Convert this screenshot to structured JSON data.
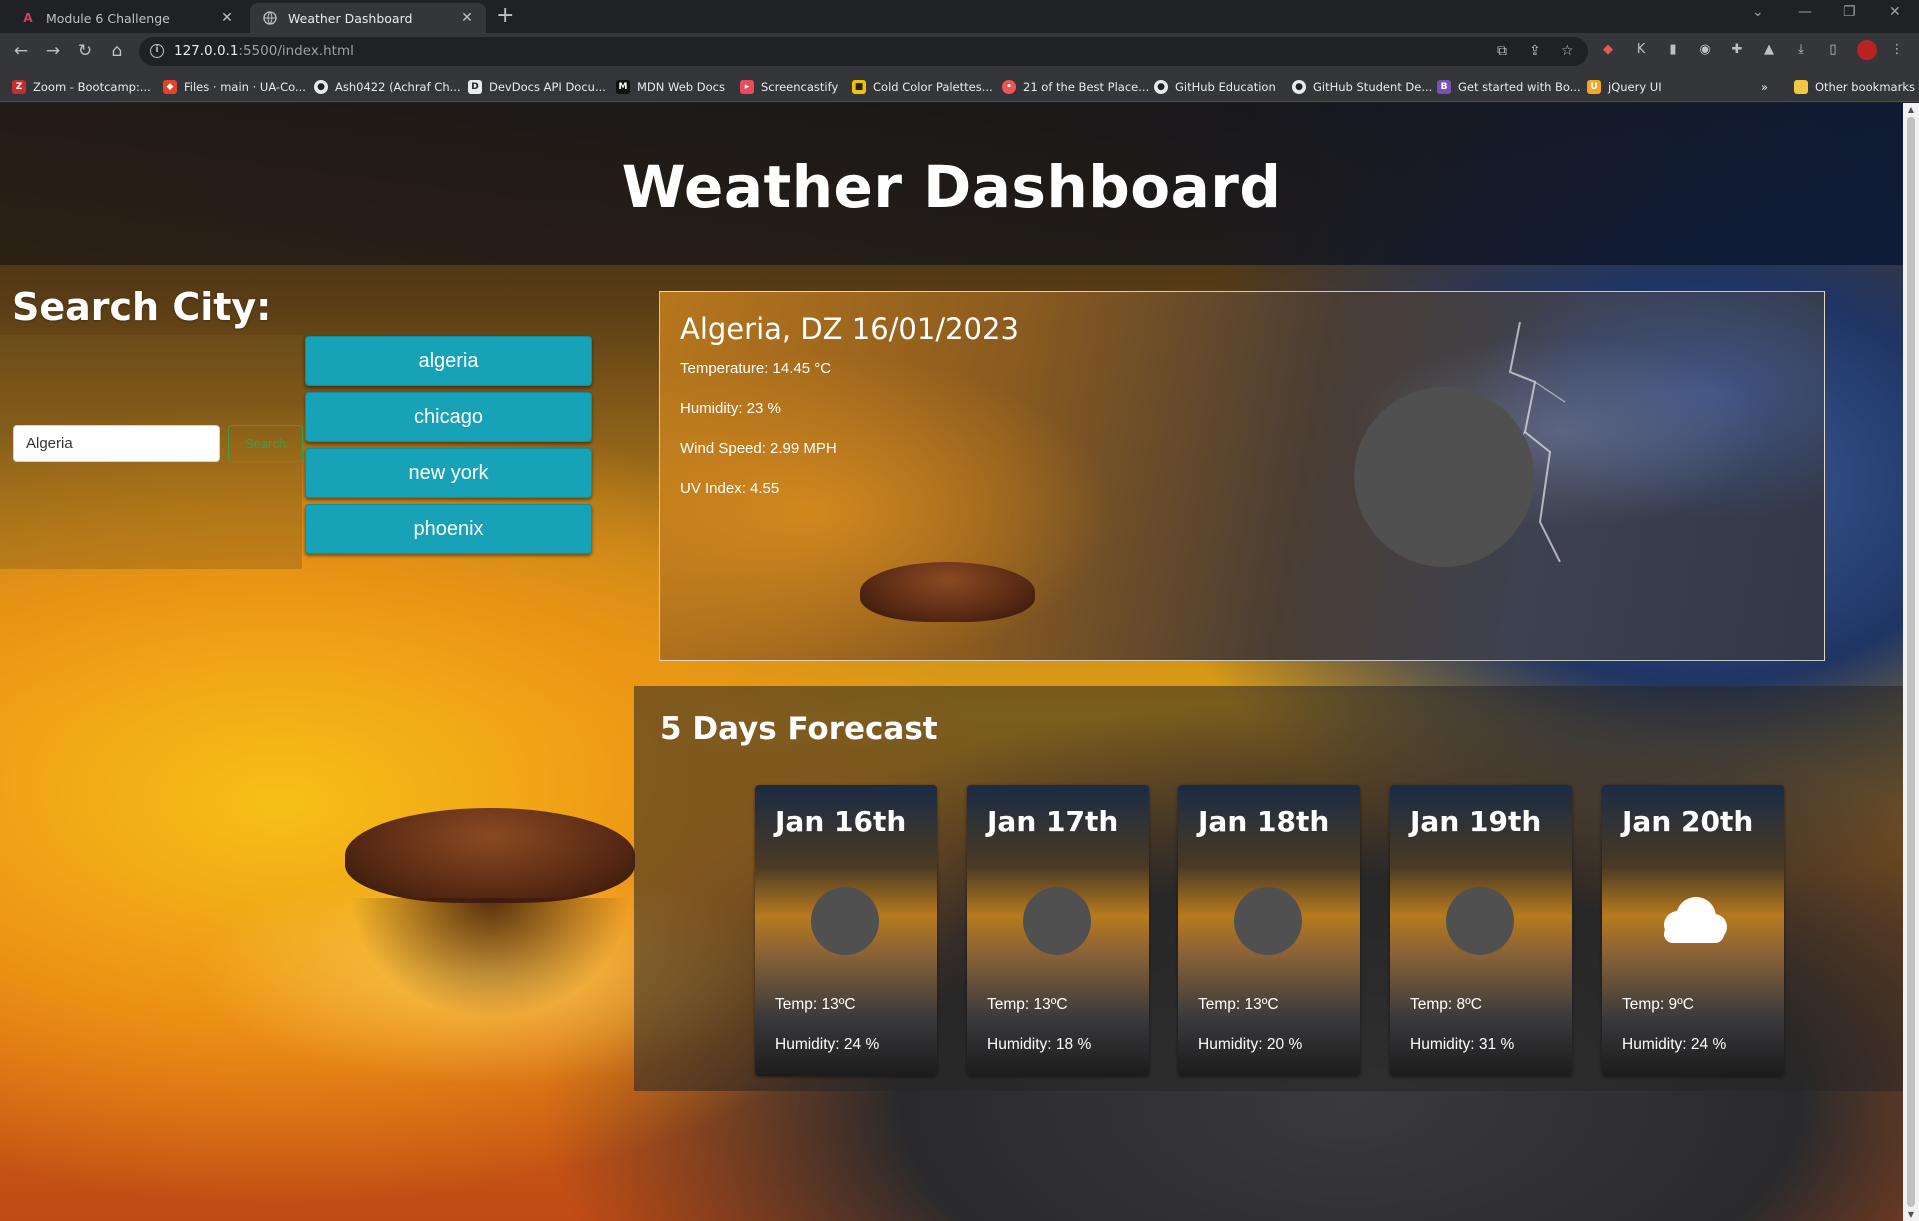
{
  "browser": {
    "tabs": [
      {
        "title": "Module 6 Challenge",
        "active": false
      },
      {
        "title": "Weather Dashboard",
        "active": true
      }
    ],
    "url_host": "127.0.0.1",
    "url_rest": ":5500/index.html",
    "bookmarks": [
      {
        "label": "Zoom - Bootcamp:...",
        "icon": "zoom-icon",
        "color": "#c32e2e"
      },
      {
        "label": "Files · main · UA-Co...",
        "icon": "gitlab-icon",
        "color": "#e24329"
      },
      {
        "label": "Ash0422 (Achraf Ch...",
        "icon": "github-icon",
        "color": "#e8eaed"
      },
      {
        "label": "DevDocs API Docu...",
        "icon": "devdocs-icon",
        "color": "#e8eaed"
      },
      {
        "label": "MDN Web Docs",
        "icon": "mdn-icon",
        "color": "#111111"
      },
      {
        "label": "Screencastify",
        "icon": "screencastify-icon",
        "color": "#ea4c5c"
      },
      {
        "label": "Cold Color Palettes...",
        "icon": "palette-icon",
        "color": "#f0c400"
      },
      {
        "label": "21 of the Best Place...",
        "icon": "pin-icon",
        "color": "#e55"
      },
      {
        "label": "GitHub Education",
        "icon": "github-icon",
        "color": "#e8eaed"
      },
      {
        "label": "GitHub Student De...",
        "icon": "github-icon",
        "color": "#e8eaed"
      },
      {
        "label": "Get started with Bo...",
        "icon": "bootstrap-icon",
        "color": "#7952b3"
      },
      {
        "label": "jQuery UI",
        "icon": "jquery-icon",
        "color": "#f5a623"
      }
    ],
    "other_bookmarks": "Other bookmarks"
  },
  "page": {
    "title": "Weather Dashboard",
    "search": {
      "heading": "Search City:",
      "input_value": "Algeria",
      "button_label": "Search",
      "history": [
        "algeria",
        "chicago",
        "new york",
        "phoenix"
      ]
    },
    "current": {
      "title": "Algeria, DZ 16/01/2023",
      "temperature": "Temperature: 14.45 °C",
      "humidity": "Humidity: 23 %",
      "wind": "Wind Speed: 2.99 MPH",
      "uv": "UV Index: 4.55"
    },
    "forecast": {
      "heading": "5 Days Forecast",
      "days": [
        {
          "date": "Jan 16th",
          "temp": "Temp: 13ºC",
          "humidity": "Humidity: 24 %",
          "icon": "missing-icon"
        },
        {
          "date": "Jan 17th",
          "temp": "Temp: 13ºC",
          "humidity": "Humidity: 18 %",
          "icon": "missing-icon"
        },
        {
          "date": "Jan 18th",
          "temp": "Temp: 13ºC",
          "humidity": "Humidity: 20 %",
          "icon": "missing-icon"
        },
        {
          "date": "Jan 19th",
          "temp": "Temp: 8ºC",
          "humidity": "Humidity: 31 %",
          "icon": "missing-icon"
        },
        {
          "date": "Jan 20th",
          "temp": "Temp: 9ºC",
          "humidity": "Humidity: 24 %",
          "icon": "cloud-icon"
        }
      ]
    },
    "colors": {
      "city_button": "#17a2b8",
      "search_button": "#3f9e3f"
    }
  }
}
